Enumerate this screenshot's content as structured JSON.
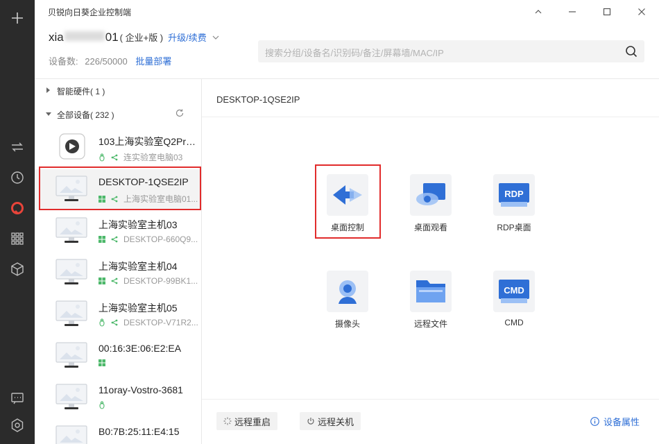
{
  "window": {
    "title": "贝锐向日葵企业控制端"
  },
  "account": {
    "name_prefix": "xia",
    "name_suffix": "01",
    "edition": "( 企业+版 )",
    "upgrade_label": "升级/续费",
    "device_count_label": "设备数:",
    "device_count": "226/50000",
    "bulk_deploy_label": "批量部署"
  },
  "search": {
    "placeholder": "搜索分组/设备名/识别码/备注/屏幕墙/MAC/IP"
  },
  "tree": {
    "groups": [
      {
        "label": "智能硬件( 1 )"
      },
      {
        "label": "全部设备( 232 )"
      }
    ],
    "devices": [
      {
        "name": "103上海实验室Q2Pro-...",
        "os": "linux",
        "remark": "连实验室电脑03",
        "thumb": "hardware"
      },
      {
        "name": "DESKTOP-1QSE2IP",
        "os": "windows",
        "remark": "上海实验室电脑01...",
        "thumb": "monitor"
      },
      {
        "name": "上海实验室主机03",
        "os": "windows",
        "remark": "DESKTOP-660Q9...",
        "thumb": "monitor"
      },
      {
        "name": "上海实验室主机04",
        "os": "windows",
        "remark": "DESKTOP-99BK1...",
        "thumb": "monitor"
      },
      {
        "name": "上海实验室主机05",
        "os": "linux",
        "remark": "DESKTOP-V71R2...",
        "thumb": "monitor"
      },
      {
        "name": "00:16:3E:06:E2:EA",
        "os": "windows",
        "remark": "",
        "thumb": "monitor"
      },
      {
        "name": "11oray-Vostro-3681",
        "os": "linux",
        "remark": "",
        "thumb": "monitor"
      },
      {
        "name": "B0:7B:25:11:E4:15",
        "os": "",
        "remark": "",
        "thumb": "monitor"
      }
    ]
  },
  "pane": {
    "device_title": "DESKTOP-1QSE2IP",
    "tools": [
      {
        "label": "桌面控制",
        "icon": "desktop-control-icon"
      },
      {
        "label": "桌面观看",
        "icon": "desktop-view-icon"
      },
      {
        "label": "RDP桌面",
        "icon": "rdp-icon",
        "badge": "RDP"
      },
      {
        "label": "摄像头",
        "icon": "camera-icon"
      },
      {
        "label": "远程文件",
        "icon": "folder-icon"
      },
      {
        "label": "CMD",
        "icon": "cmd-icon",
        "badge": "CMD"
      }
    ],
    "footer": {
      "restart_label": "远程重启",
      "shutdown_label": "远程关机",
      "properties_label": "设备属性"
    }
  },
  "colors": {
    "accent": "#2f6fd6",
    "highlight": "#e12b2b",
    "rail": "#2b2b2b",
    "brand": "#e8443a"
  }
}
